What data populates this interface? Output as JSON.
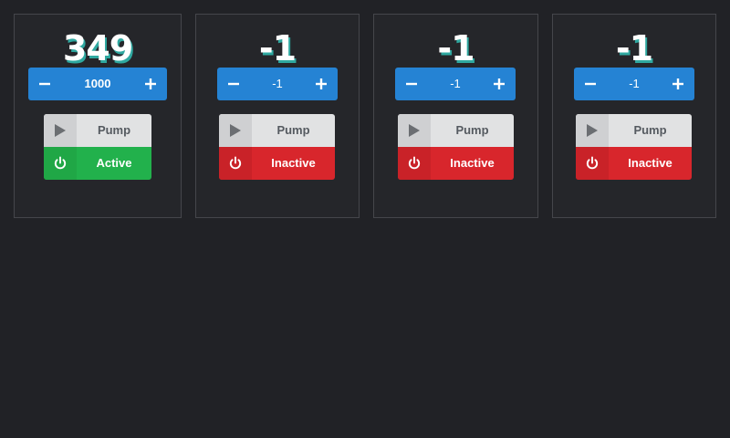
{
  "panels": [
    {
      "value": "349",
      "stepper_value": "1000",
      "pump_label": "Pump",
      "status_label": "Active",
      "status": "active"
    },
    {
      "value": "-1",
      "stepper_value": "-1",
      "pump_label": "Pump",
      "status_label": "Inactive",
      "status": "inactive"
    },
    {
      "value": "-1",
      "stepper_value": "-1",
      "pump_label": "Pump",
      "status_label": "Inactive",
      "status": "inactive"
    },
    {
      "value": "-1",
      "stepper_value": "-1",
      "pump_label": "Pump",
      "status_label": "Inactive",
      "status": "inactive"
    }
  ],
  "icons": {
    "decrement": "minus-icon",
    "increment": "plus-icon",
    "pump": "play-icon",
    "status": "power-icon"
  },
  "colors": {
    "background": "#212226",
    "stepper": "#2583d4",
    "active": "#22b14c",
    "inactive": "#d8262c",
    "pump": "#e1e2e3"
  }
}
